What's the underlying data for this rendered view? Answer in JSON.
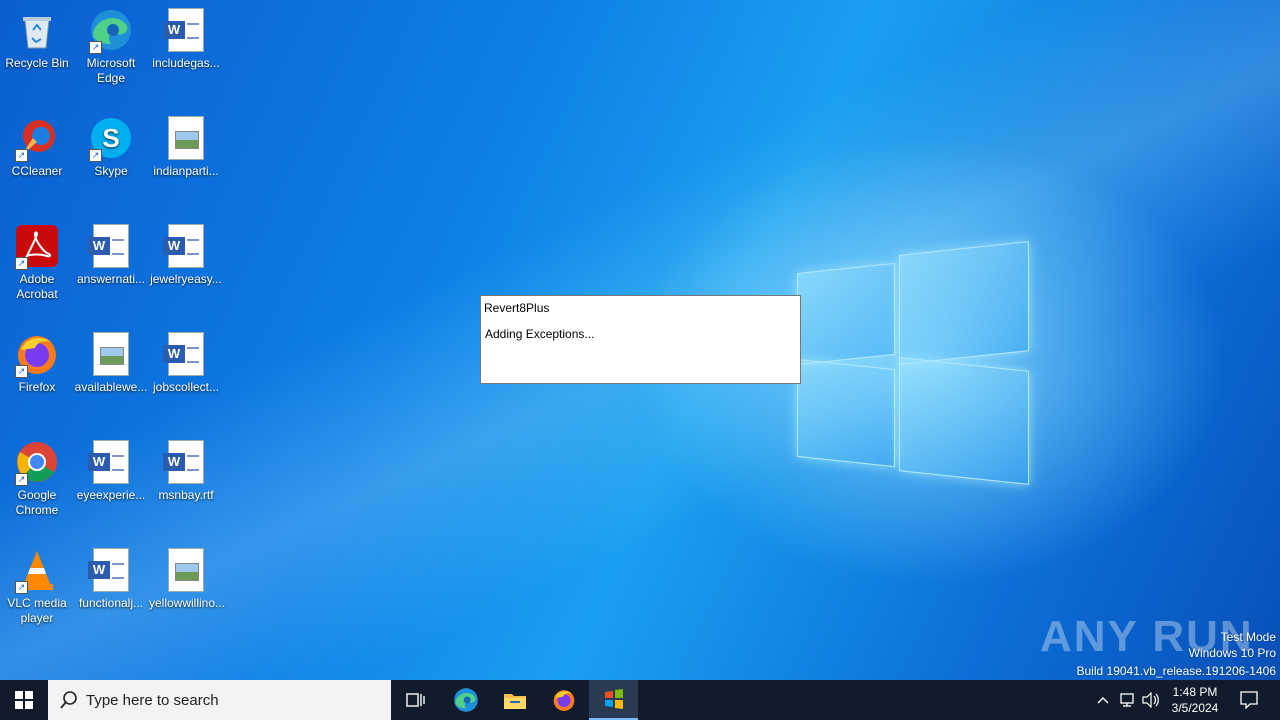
{
  "desktop": {
    "icons": [
      {
        "label": "Recycle Bin",
        "icon": "recycle-bin-icon"
      },
      {
        "label": "Microsoft Edge",
        "icon": "edge-icon"
      },
      {
        "label": "includegas...",
        "icon": "word-doc-icon"
      },
      {
        "label": "CCleaner",
        "icon": "ccleaner-icon"
      },
      {
        "label": "Skype",
        "icon": "skype-icon"
      },
      {
        "label": "indianparti...",
        "icon": "image-file-icon"
      },
      {
        "label": "Adobe Acrobat",
        "icon": "acrobat-icon"
      },
      {
        "label": "answernati...",
        "icon": "word-doc-icon"
      },
      {
        "label": "jewelryeasy...",
        "icon": "word-doc-icon"
      },
      {
        "label": "Firefox",
        "icon": "firefox-icon"
      },
      {
        "label": "availablewe...",
        "icon": "image-file-icon"
      },
      {
        "label": "jobscollect...",
        "icon": "word-doc-icon"
      },
      {
        "label": "Google Chrome",
        "icon": "chrome-icon"
      },
      {
        "label": "eyeexperie...",
        "icon": "word-doc-icon"
      },
      {
        "label": "msnbay.rtf",
        "icon": "word-doc-icon"
      },
      {
        "label": "VLC media player",
        "icon": "vlc-icon"
      },
      {
        "label": "functionalj...",
        "icon": "word-doc-icon"
      },
      {
        "label": "yellowwillino...",
        "icon": "image-file-icon"
      }
    ]
  },
  "dialog": {
    "title": "Revert8Plus",
    "message": "Adding Exceptions..."
  },
  "watermark": {
    "brand": "ANY RUN",
    "mode": "Test Mode",
    "edition": "Windows 10 Pro",
    "build": "Build 19041.vb_release.191206-1406"
  },
  "taskbar": {
    "search_placeholder": "Type here to search",
    "time": "1:48 PM",
    "date": "3/5/2024"
  },
  "colors": {
    "taskbar_bg": "#101c2c",
    "desktop_blue": "#0e7fe6"
  }
}
